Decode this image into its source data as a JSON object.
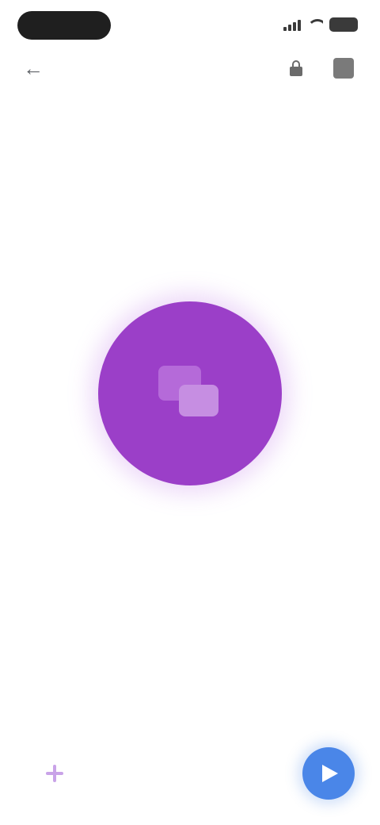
{
  "status_bar": {
    "time": "",
    "battery": ""
  },
  "app_bar": {
    "title": "",
    "back_icon": "back-arrow-icon",
    "actions": [
      "lock-icon",
      "more-icon"
    ]
  },
  "main": {
    "headline": "",
    "info_text": "",
    "info_link": "",
    "action_label": ""
  },
  "compose": {
    "placeholder": "",
    "send_icon": "send-icon"
  },
  "colors": {
    "hero": "#9b3fc8",
    "accent": "#4a86e8"
  }
}
